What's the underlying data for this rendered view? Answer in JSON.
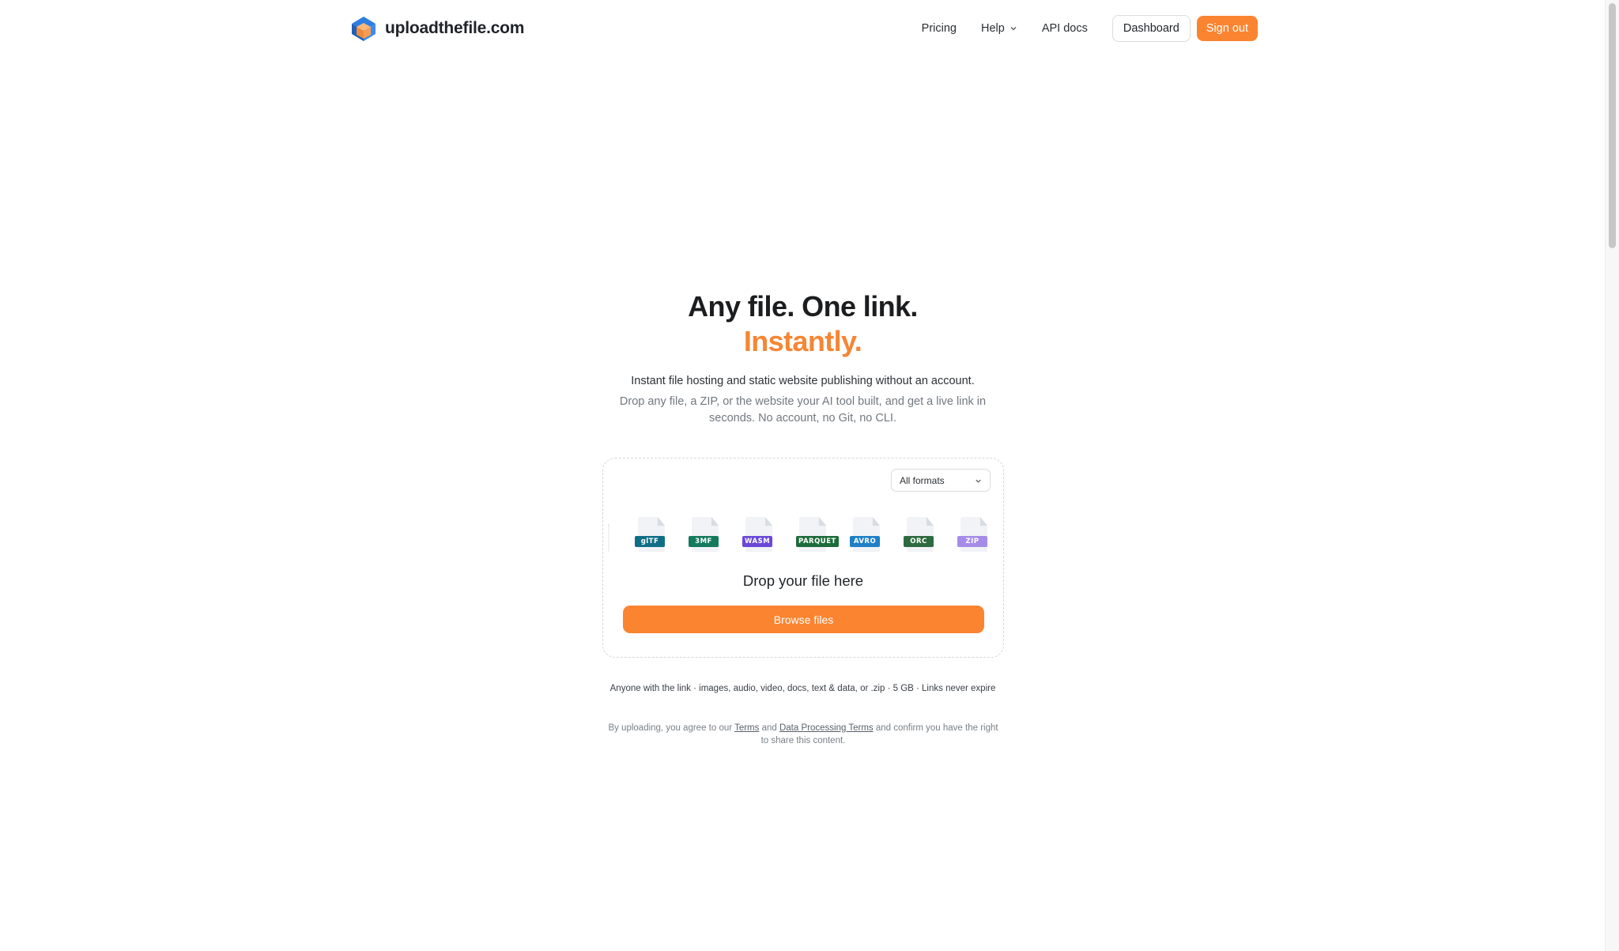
{
  "brand": {
    "name": "uploadthefile.com",
    "logo_icon": "package-box-icon"
  },
  "nav": {
    "pricing": "Pricing",
    "help": "Help",
    "api_docs": "API docs",
    "dashboard": "Dashboard",
    "sign_out": "Sign out"
  },
  "hero": {
    "title_line1": "Any file. One link.",
    "title_line2": "Instantly.",
    "subtitle": "Instant file hosting and static website publishing without an account.",
    "description": "Drop any file, a ZIP, or the website your AI tool built, and get a live link in seconds. No account, no Git, no CLI."
  },
  "uploader": {
    "format_filter": "All formats",
    "file_types": [
      {
        "label": "glTF",
        "color": "#0f6e86"
      },
      {
        "label": "3MF",
        "color": "#147a5d"
      },
      {
        "label": "WASM",
        "color": "#6a48d9"
      },
      {
        "label": "PARQUET",
        "color": "#1d6b3a"
      },
      {
        "label": "AVRO",
        "color": "#1f7fc7"
      },
      {
        "label": "ORC",
        "color": "#2e6a3f"
      },
      {
        "label": "ZIP",
        "color": "#a58ce8"
      }
    ],
    "drop_text": "Drop your file here",
    "browse_label": "Browse files"
  },
  "info_line": "Anyone with the link · images, audio, video, docs, text & data, or .zip · 5 GB · Links never expire",
  "terms": {
    "prefix": "By uploading, you agree to our",
    "terms_link": "Terms",
    "and": "and",
    "dpt_link": "Data Processing Terms",
    "suffix": "and confirm you have the right to share this content."
  },
  "colors": {
    "accent": "#fb8431",
    "accent_text": "#f58634"
  }
}
